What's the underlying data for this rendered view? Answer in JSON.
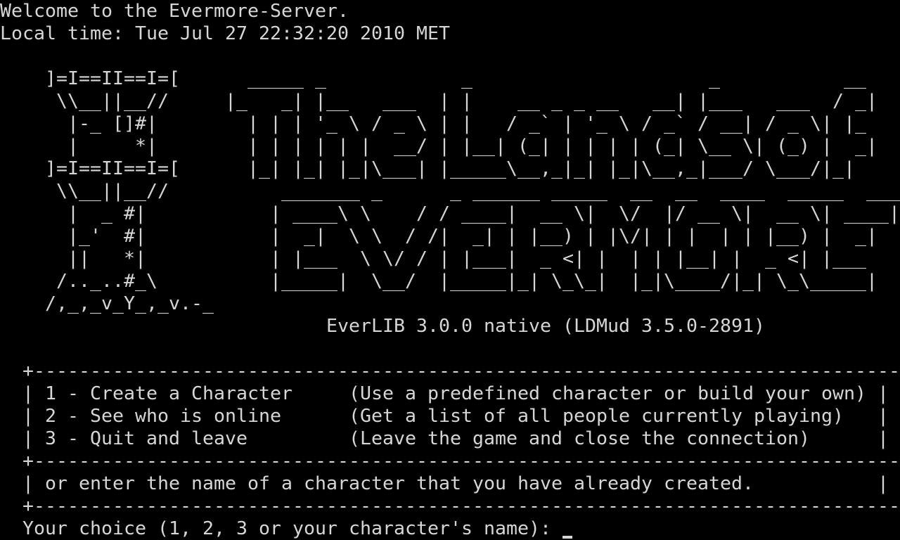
{
  "terminal": {
    "cols": 80,
    "rows": 24,
    "fg": "#d6d6d6",
    "bg": "#000000",
    "lines": [
      "Welcome to the Evermore-Server.",
      "Local time: Tue Jul 27 22:32:20 2010 MET",
      "",
      "    ]=I==II==I=[      _____ _            _                     _           __",
      "     \\\\__||__//     |_   _| |__   ___  | |    __ _ _ __   __| |___   ___  / _|",
      "      |-_ []#|        | | | '_ \\ / _ \\ | |   / _` | '_ \\ / _` / __| / _ \\| |_",
      "      |     *|        | | | | | |  __/ | |__| (_| | | | | (_| \\__ \\| (_) |  _|",
      "    ]=I==II==I=[      |_| |_| |_|\\___| |_____\\__,_|_| |_|\\__,_|___/ \\___/|_|",
      "     \\\\__||__//          _______ _      _ ______ _____  __  __  ____  _____  ______",
      "      |  _ #|           | ____\\ \\    / / ____|  __ \\|  \\/  |/ __ \\|  __ \\| ____|",
      "      |_'  #|           |  _|  \\ \\  / /|  _| | |__) | |\\/| | |  | | |__) |  _|",
      "      ||   *|           | |___  \\ \\/ / | |___|  _ <| |  | | |__| |  _ <| |___",
      "     /.._..#_\\          |_____|  \\__/  |_____|_| \\_\\_|  |_|\\____/|_| \\_\\_____|",
      "    /,_,_v_Y_,_v.-_",
      "                             EverLIB 3.0.0 native (LDMud 3.5.0-2891)",
      "",
      "  +-----------------------------------------------------------------------------+",
      "  | 1 - Create a Character     (Use a predefined character or build your own) |",
      "  | 2 - See who is online      (Get a list of all people currently playing)   |",
      "  | 3 - Quit and leave         (Leave the game and close the connection)      |",
      "  +-----------------------------------------------------------------------------+",
      "  | or enter the name of a character that you have already created.           |",
      "  +-----------------------------------------------------------------------------+",
      "  Your choice (1, 2, 3 or your character's name): "
    ]
  }
}
